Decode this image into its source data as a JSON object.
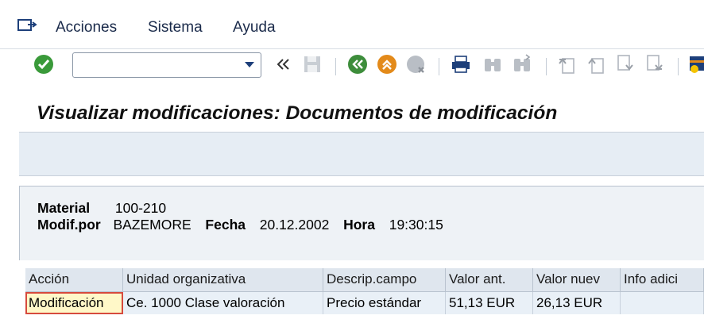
{
  "menu": {
    "items": [
      {
        "label": "Acciones"
      },
      {
        "label": "Sistema"
      },
      {
        "label": "Ayuda"
      }
    ]
  },
  "toolbar": {
    "command_field_value": "",
    "icons": [
      "enter-icon",
      "back-arrows-icon",
      "save-icon",
      "back-icon",
      "exit-icon",
      "cancel-icon",
      "print-icon",
      "find-icon",
      "find-next-icon",
      "first-page-icon",
      "previous-page-icon",
      "next-page-icon",
      "last-page-icon",
      "create-session-icon"
    ]
  },
  "title": "Visualizar modificaciones: Documentos de modificación",
  "header": {
    "material_label": "Material",
    "material_value": "100-210",
    "modif_label": "Modif.por",
    "modif_value": "BAZEMORE",
    "fecha_label": "Fecha",
    "fecha_value": "20.12.2002",
    "hora_label": "Hora",
    "hora_value": "19:30:15"
  },
  "table": {
    "columns": [
      "Acción",
      "Unidad organizativa",
      "Descrip.campo",
      "Valor ant.",
      "Valor nuev",
      "Info adici"
    ],
    "rows": [
      [
        "Modificación",
        "Ce.  1000 Clase valoración",
        "Precio estándar",
        "51,13 EUR",
        "26,13 EUR",
        ""
      ]
    ]
  },
  "colors": {
    "accent": "#1d3f7a",
    "header_bg": "#dfe6ee",
    "row_bg": "#e9f0f7",
    "focus_border": "#d64a3e"
  }
}
